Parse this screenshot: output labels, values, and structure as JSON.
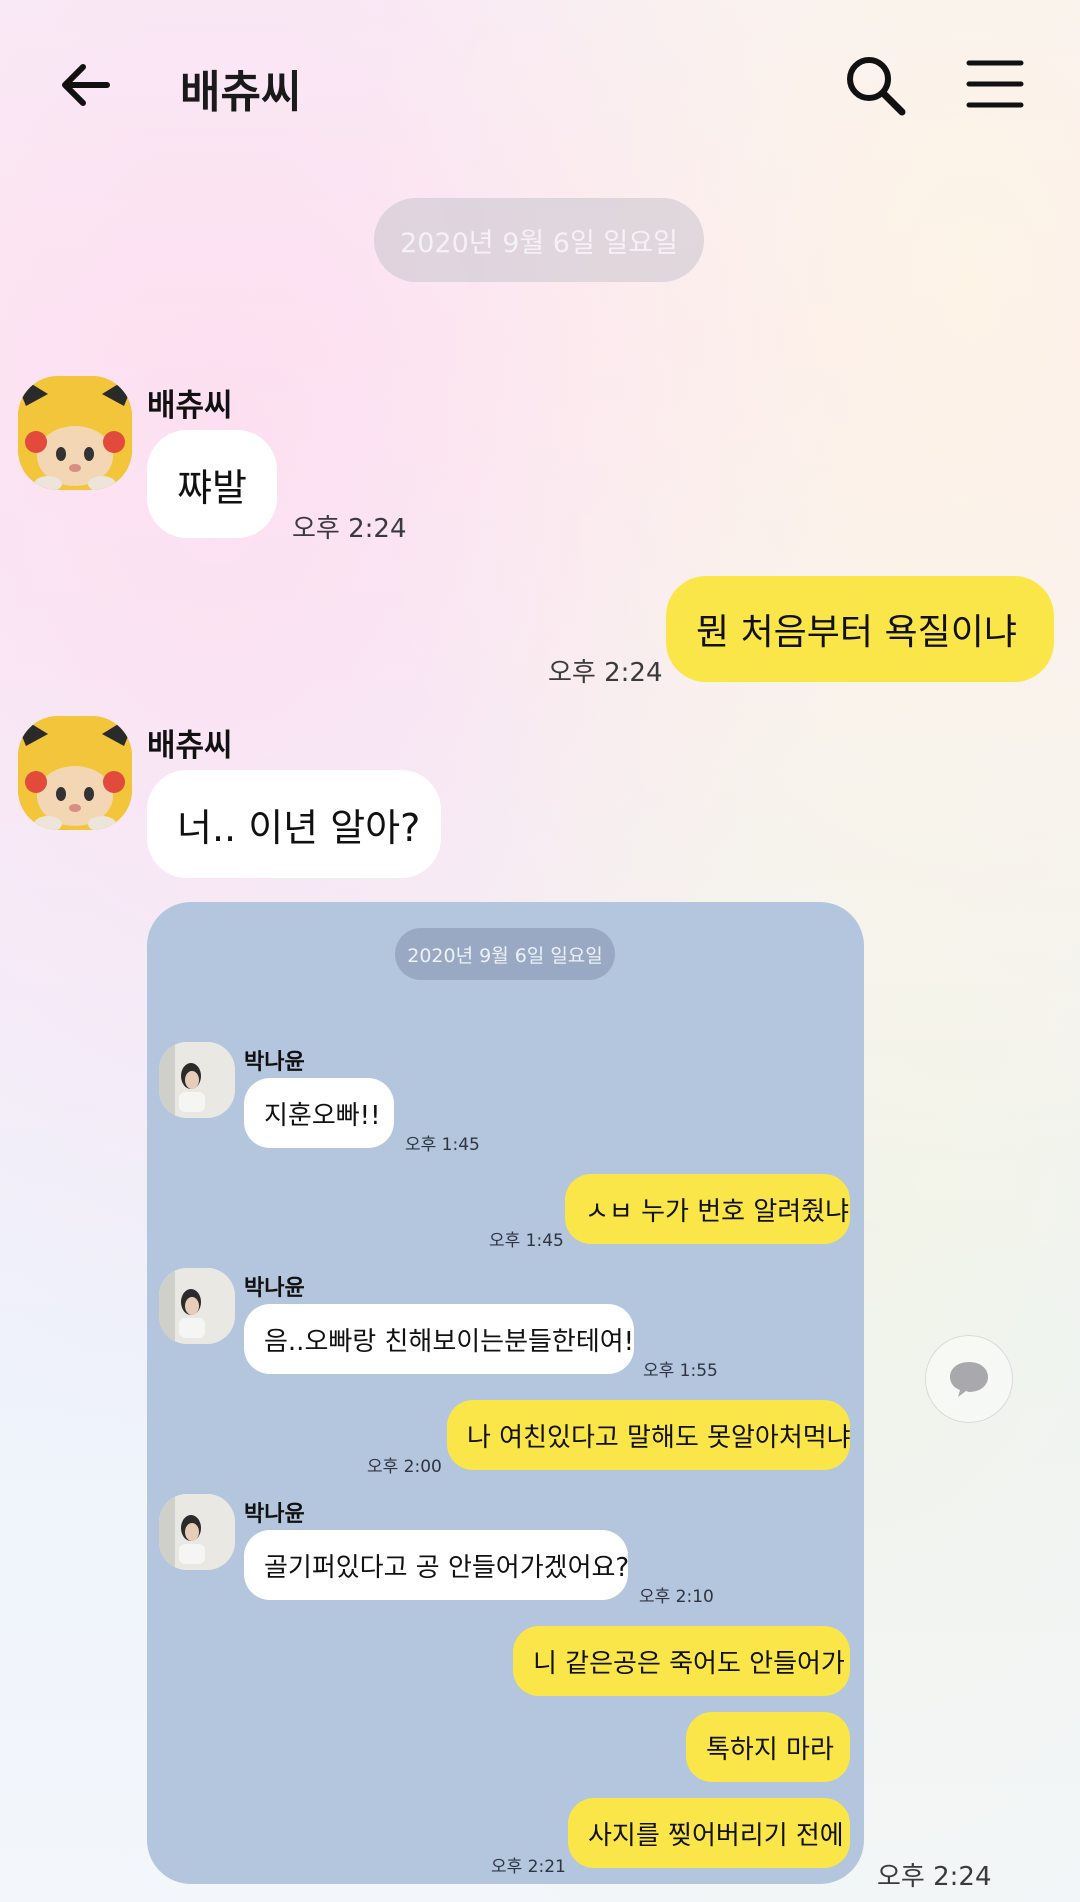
{
  "header": {
    "title": "배츄씨",
    "back_icon": "arrow-left-icon",
    "search_icon": "search-icon",
    "menu_icon": "menu-icon"
  },
  "date_divider": "2020년 9월 6일 일요일",
  "messages": [
    {
      "sender": "배츄씨",
      "text": "쨔발",
      "time": "오후 2:24"
    },
    {
      "text": "뭔 처음부터 욕질이냐",
      "time": "오후 2:24"
    },
    {
      "sender": "배츄씨",
      "text": "너.. 이년 알아?",
      "image_time": "오후 2:24"
    }
  ],
  "shared_image": {
    "date_divider": "2020년 9월 6일 일요일",
    "sender": "박나윤",
    "messages": [
      {
        "text": "지훈오빠!!",
        "time": "오후 1:45"
      },
      {
        "text": "ㅅㅂ 누가 번호 알려줬냐",
        "time": "오후 1:45"
      },
      {
        "text": "음..오빠랑 친해보이는분들한테여!",
        "time": "오후 1:55"
      },
      {
        "text": "나 여친있다고 말해도 못알아처먹냐",
        "time": "오후 2:00"
      },
      {
        "text": "골기퍼있다고 공 안들어가겠어요?",
        "time": "오후 2:10"
      },
      {
        "text": "니 같은공은 죽어도 안들어가"
      },
      {
        "text": "톡하지 마라"
      },
      {
        "text": "사지를 찢어버리기 전에",
        "time": "오후 2:21"
      }
    ]
  },
  "colors": {
    "outgoing_bubble": "#fbe64a",
    "incoming_bubble": "#ffffff",
    "shared_image_bg": "#b4c5de"
  },
  "comment_icon": "speech-bubble-icon"
}
